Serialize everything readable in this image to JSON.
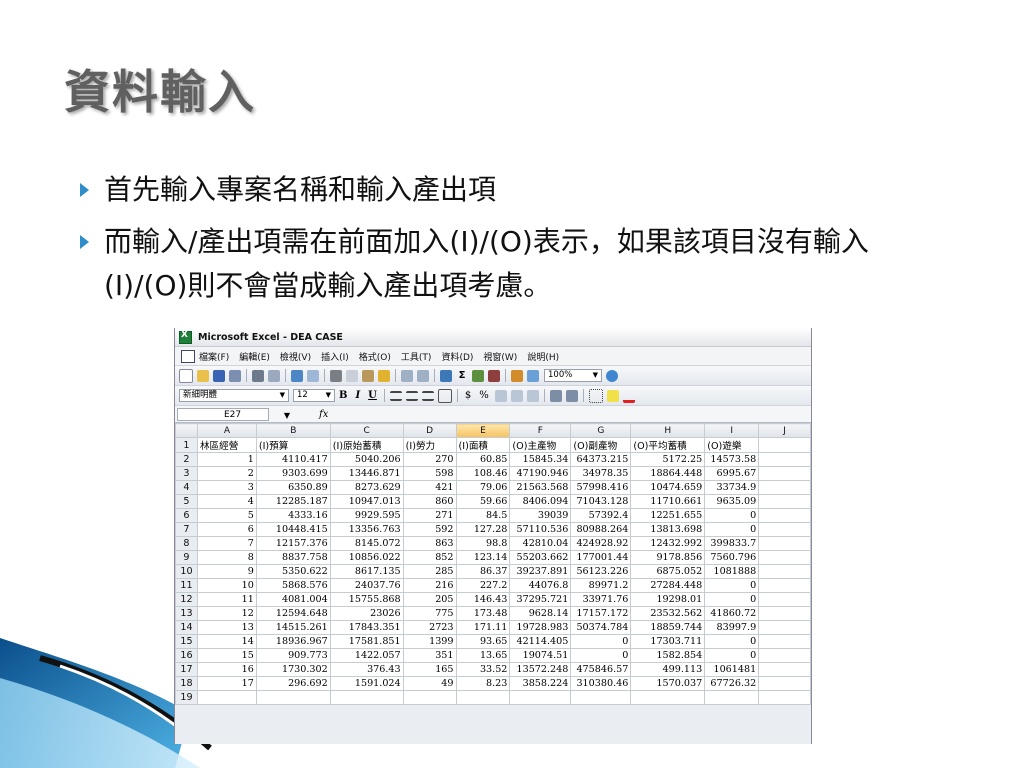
{
  "slide": {
    "title": "資料輸入",
    "bullets": [
      "首先輸入專案名稱和輸入產出項",
      "而輸入/產出項需在前面加入(I)/(O)表示，如果該項目沒有輸入(I)/(O)則不會當成輸入產出項考慮。"
    ]
  },
  "window": {
    "title": "Microsoft Excel - DEA CASE"
  },
  "menu": [
    "檔案(F)",
    "編輯(E)",
    "檢視(V)",
    "插入(I)",
    "格式(O)",
    "工具(T)",
    "資料(D)",
    "視窗(W)",
    "說明(H)"
  ],
  "toolbar": {
    "zoom": "100%",
    "font_name": "新細明體",
    "font_size": "12",
    "bold": "B",
    "italic": "I",
    "underline": "U",
    "currency": "$",
    "percent": "%"
  },
  "formula_bar": {
    "name_box": "E27",
    "fx": "fx"
  },
  "sheet": {
    "columns": [
      "A",
      "B",
      "C",
      "D",
      "E",
      "F",
      "G",
      "H",
      "I",
      "J"
    ],
    "selected_column": "E",
    "row_numbers": [
      "1",
      "2",
      "3",
      "4",
      "5",
      "6",
      "7",
      "8",
      "9",
      "10",
      "11",
      "12",
      "13",
      "14",
      "15",
      "16",
      "17",
      "18",
      "19"
    ],
    "header_row": [
      "林區經營",
      "(I)預算",
      "(I)原始蓄積",
      "(I)勞力",
      "(I)面積",
      "(O)主產物",
      "(O)副產物",
      "(O)平均蓄積",
      "(O)遊樂",
      ""
    ],
    "rows": [
      [
        "1",
        "4110.417",
        "5040.206",
        "270",
        "60.85",
        "15845.34",
        "64373.215",
        "5172.25",
        "14573.58",
        ""
      ],
      [
        "2",
        "9303.699",
        "13446.871",
        "598",
        "108.46",
        "47190.946",
        "34978.35",
        "18864.448",
        "6995.67",
        ""
      ],
      [
        "3",
        "6350.89",
        "8273.629",
        "421",
        "79.06",
        "21563.568",
        "57998.416",
        "10474.659",
        "33734.9",
        ""
      ],
      [
        "4",
        "12285.187",
        "10947.013",
        "860",
        "59.66",
        "8406.094",
        "71043.128",
        "11710.661",
        "9635.09",
        ""
      ],
      [
        "5",
        "4333.16",
        "9929.595",
        "271",
        "84.5",
        "39039",
        "57392.4",
        "12251.655",
        "0",
        ""
      ],
      [
        "6",
        "10448.415",
        "13356.763",
        "592",
        "127.28",
        "57110.536",
        "80988.264",
        "13813.698",
        "0",
        ""
      ],
      [
        "7",
        "12157.376",
        "8145.072",
        "863",
        "98.8",
        "42810.04",
        "424928.92",
        "12432.992",
        "399833.7",
        ""
      ],
      [
        "8",
        "8837.758",
        "10856.022",
        "852",
        "123.14",
        "55203.662",
        "177001.44",
        "9178.856",
        "7560.796",
        ""
      ],
      [
        "9",
        "5350.622",
        "8617.135",
        "285",
        "86.37",
        "39237.891",
        "56123.226",
        "6875.052",
        "1081888",
        ""
      ],
      [
        "10",
        "5868.576",
        "24037.76",
        "216",
        "227.2",
        "44076.8",
        "89971.2",
        "27284.448",
        "0",
        ""
      ],
      [
        "11",
        "4081.004",
        "15755.868",
        "205",
        "146.43",
        "37295.721",
        "33971.76",
        "19298.01",
        "0",
        ""
      ],
      [
        "12",
        "12594.648",
        "23026",
        "775",
        "173.48",
        "9628.14",
        "17157.172",
        "23532.562",
        "41860.72",
        ""
      ],
      [
        "13",
        "14515.261",
        "17843.351",
        "2723",
        "171.11",
        "19728.983",
        "50374.784",
        "18859.744",
        "83997.9",
        ""
      ],
      [
        "14",
        "18936.967",
        "17581.851",
        "1399",
        "93.65",
        "42114.405",
        "0",
        "17303.711",
        "0",
        ""
      ],
      [
        "15",
        "909.773",
        "1422.057",
        "351",
        "13.65",
        "19074.51",
        "0",
        "1582.854",
        "0",
        ""
      ],
      [
        "16",
        "1730.302",
        "376.43",
        "165",
        "33.52",
        "13572.248",
        "475846.57",
        "499.113",
        "1061481",
        ""
      ],
      [
        "17",
        "296.692",
        "1591.024",
        "49",
        "8.23",
        "3858.224",
        "310380.46",
        "1570.037",
        "67726.32",
        ""
      ],
      [
        "",
        "",
        "",
        "",
        "",
        "",
        "",
        "",
        "",
        ""
      ]
    ]
  }
}
